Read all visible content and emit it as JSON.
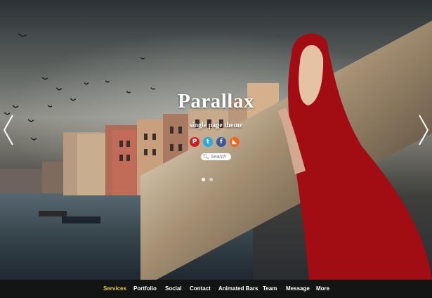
{
  "hero": {
    "title": "Parallax",
    "subtitle": "single page theme"
  },
  "socials": [
    {
      "icon": "pinterest-icon",
      "glyph": "P",
      "color": "#cb2027"
    },
    {
      "icon": "twitter-icon",
      "glyph": "t",
      "color": "#2aa9e0"
    },
    {
      "icon": "facebook-icon",
      "glyph": "f",
      "color": "#3b5998"
    },
    {
      "icon": "rss-icon",
      "glyph": "◣",
      "color": "#f26522"
    }
  ],
  "search": {
    "placeholder": "Search"
  },
  "slider": {
    "slides": 2,
    "active": 0
  },
  "arrows": {
    "prev": "chevron-left-icon",
    "next": "chevron-right-icon"
  },
  "nav": {
    "active_color": "#e9c34a",
    "items": [
      {
        "label": "Services"
      },
      {
        "label": "Portfolio"
      },
      {
        "label": "Social"
      },
      {
        "label": "Contact"
      },
      {
        "label": "Animated Bars"
      },
      {
        "label": "Team"
      },
      {
        "label": "Message"
      },
      {
        "label": "More"
      }
    ]
  }
}
